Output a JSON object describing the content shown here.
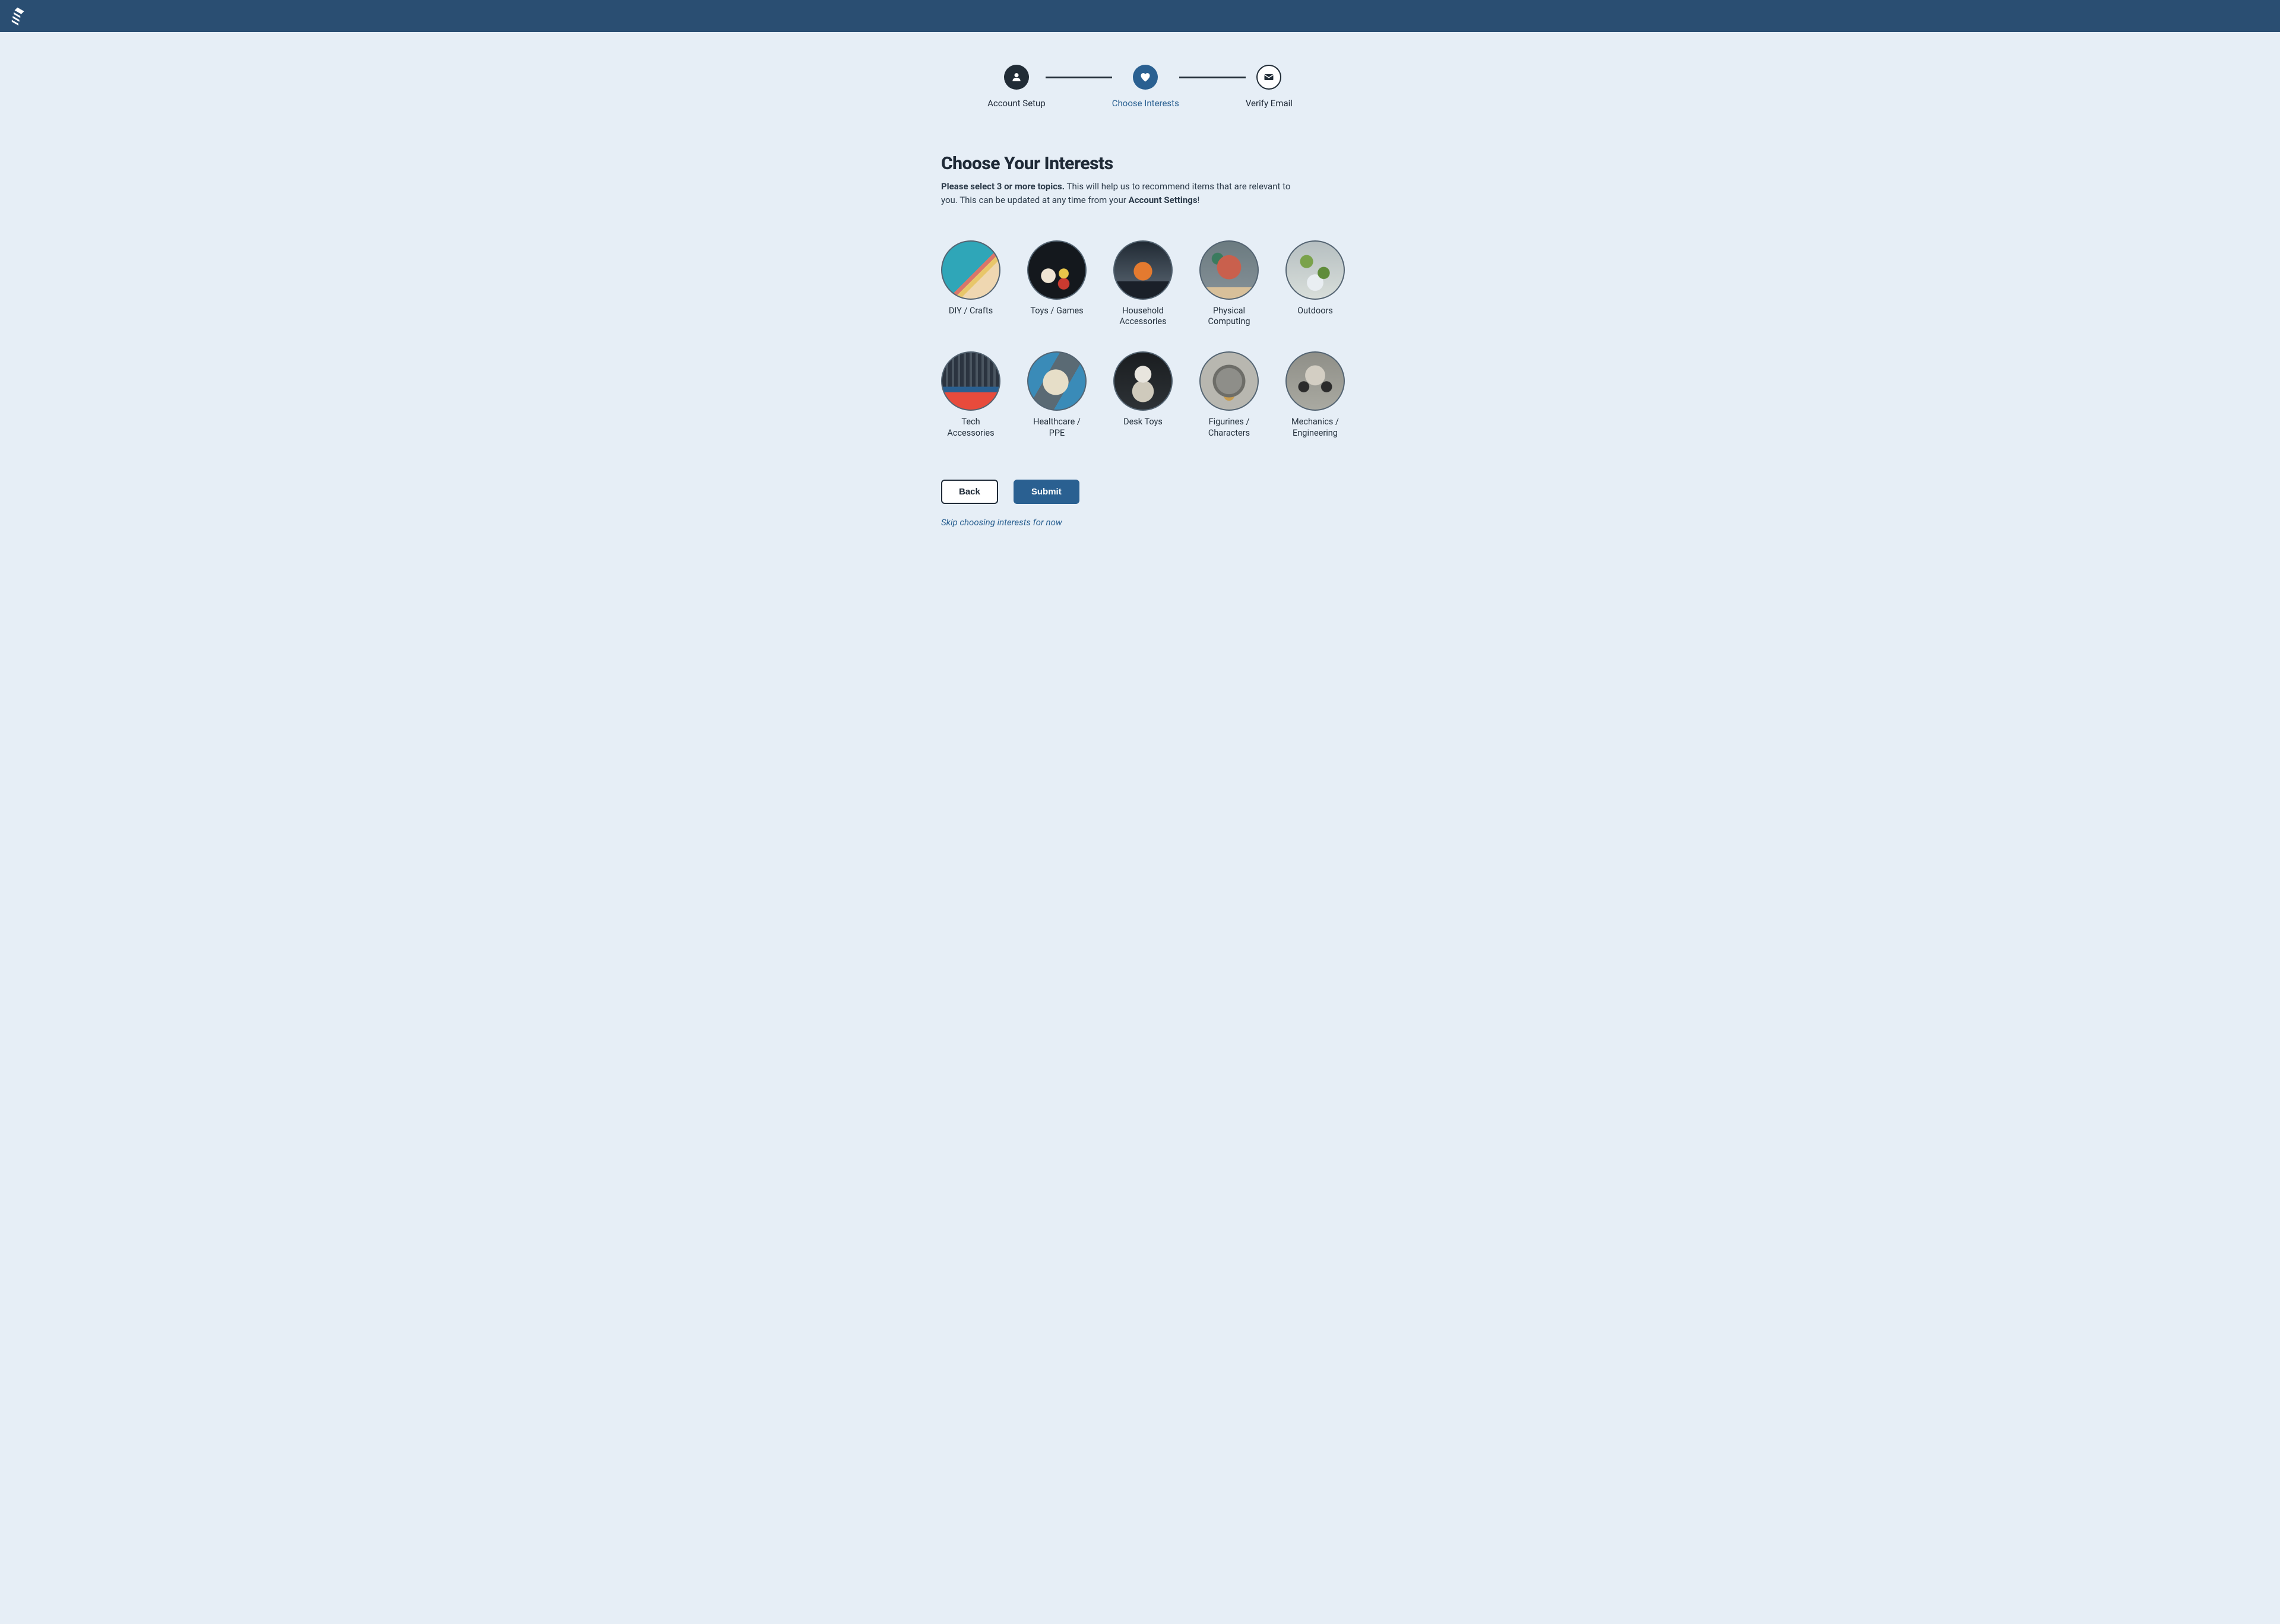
{
  "stepper": {
    "steps": [
      {
        "label": "Account Setup",
        "state": "done",
        "icon": "user-icon"
      },
      {
        "label": "Choose Interests",
        "state": "active",
        "icon": "heart-icon"
      },
      {
        "label": "Verify Email",
        "state": "pending",
        "icon": "envelope-icon"
      }
    ]
  },
  "page": {
    "title": "Choose Your Interests",
    "sub_bold": "Please select 3 or more topics.",
    "sub_text_1": " This will help us to recommend items that are relevant to you. This can be updated at any time from your ",
    "sub_link": "Account Settings",
    "sub_text_2": "!"
  },
  "interests": [
    {
      "label": "DIY / Crafts",
      "img_class": "faux-diy"
    },
    {
      "label": "Toys / Games",
      "img_class": "faux-toys"
    },
    {
      "label": "Household Accessories",
      "img_class": "faux-household"
    },
    {
      "label": "Physical Computing",
      "img_class": "faux-physical"
    },
    {
      "label": "Outdoors",
      "img_class": "faux-outdoors"
    },
    {
      "label": "Tech Accessories",
      "img_class": "faux-tech"
    },
    {
      "label": "Healthcare / PPE",
      "img_class": "faux-health"
    },
    {
      "label": "Desk Toys",
      "img_class": "faux-desk"
    },
    {
      "label": "Figurines / Characters",
      "img_class": "faux-figurine"
    },
    {
      "label": "Mechanics / Engineering",
      "img_class": "faux-mech"
    }
  ],
  "buttons": {
    "back": "Back",
    "submit": "Submit"
  },
  "skip_text": "Skip choosing interests for now"
}
